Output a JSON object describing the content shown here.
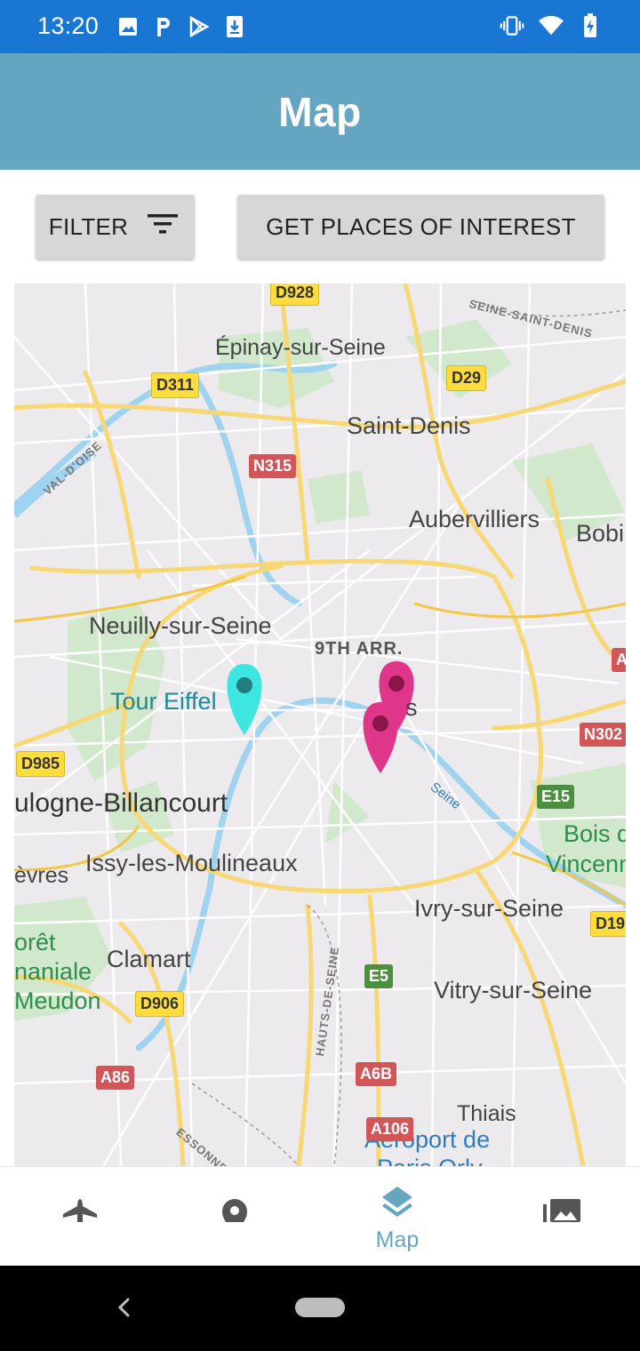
{
  "status_bar": {
    "time": "13:20",
    "left_icons": [
      "image-icon",
      "parking-p-icon",
      "play-store-icon",
      "download-icon"
    ],
    "right_icons": [
      "vibrate-icon",
      "wifi-icon",
      "battery-charging-icon"
    ]
  },
  "app_bar": {
    "title": "Map"
  },
  "buttons": {
    "filter_label": "FILTER",
    "filter_icon": "filter-list-icon",
    "poi_label": "GET PLACES OF INTEREST"
  },
  "map": {
    "labels": {
      "epinay": "Épinay-sur-Seine",
      "saint_denis": "Saint-Denis",
      "aubervilliers": "Aubervilliers",
      "bobi": "Bobi",
      "neuilly": "Neuilly-sur-Seine",
      "arr9": "9TH ARR.",
      "tour_eiffel": "Tour Eiffel",
      "paris_partial": "s",
      "boulogne": "ulogne-Billancourt",
      "issy": "Issy-les-Moulineaux",
      "sevres": "èvres",
      "ivry": "Ivry-sur-Seine",
      "bois_de": "Bois d",
      "vincennes": "Vincenn",
      "foret": "orêt",
      "domaniale": "naniale",
      "meudon": "Meudon",
      "clamart": "Clamart",
      "vitry": "Vitry-sur-Seine",
      "thiais": "Thiais",
      "aeroport": "Aéroport de",
      "paris_orly": "Paris Orly",
      "seine_saint_denis": "SEINE-SAINT-DENIS",
      "val_doise": "VAL-D'OISE",
      "hauts_de_seine": "HAUTS-DE-SEINE",
      "essonne": "ESSONNE",
      "seine_river": "Seine"
    },
    "shields": {
      "d928": "D928",
      "d311": "D311",
      "d29": "D29",
      "n315": "N315",
      "a_partial": "A",
      "n302": "N302",
      "d985": "D985",
      "e15": "E15",
      "d19": "D19",
      "e5": "E5",
      "d906": "D906",
      "a86": "A86",
      "a6b": "A6B",
      "a106": "A106"
    },
    "markers": [
      {
        "name": "teal-marker",
        "color": "#3de6e0"
      },
      {
        "name": "pink-marker-1",
        "color": "#e0368a"
      },
      {
        "name": "pink-marker-2",
        "color": "#e0368a"
      }
    ]
  },
  "bottom_nav": {
    "items": [
      {
        "icon": "airplane-icon",
        "label": ""
      },
      {
        "icon": "location-pin-icon",
        "label": ""
      },
      {
        "icon": "layers-icon",
        "label": "Map"
      },
      {
        "icon": "photo-library-icon",
        "label": ""
      }
    ],
    "active_color": "#64a6c2"
  },
  "colors": {
    "status_bar": "#1976d2",
    "app_bar": "#64a6c2",
    "button_bg": "#d6d7d7"
  }
}
